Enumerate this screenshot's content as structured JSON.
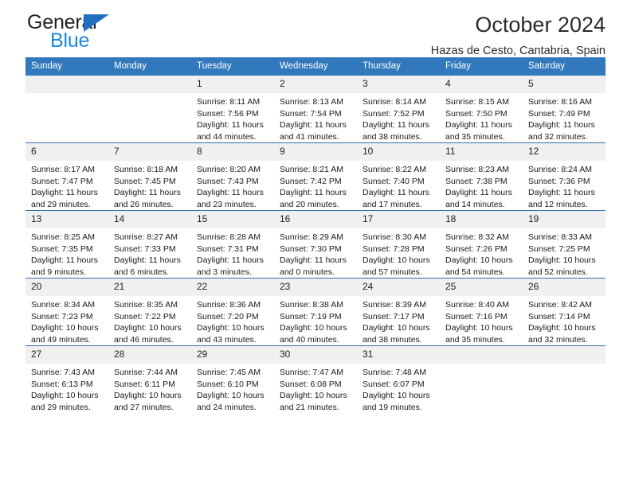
{
  "brand": {
    "name_dark": "General",
    "name_blue": "Blue",
    "accent_color": "#1b87dc",
    "triangle_color": "#1f6fc0"
  },
  "header": {
    "title": "October 2024",
    "subtitle": "Hazas de Cesto, Cantabria, Spain"
  },
  "theme": {
    "header_row_bg": "#3179bc",
    "header_row_text": "#ffffff",
    "week_divider": "#2e6fac",
    "daynum_bg": "#f0f0f0"
  },
  "weekdays": [
    "Sunday",
    "Monday",
    "Tuesday",
    "Wednesday",
    "Thursday",
    "Friday",
    "Saturday"
  ],
  "weeks": [
    [
      {
        "day": "",
        "sunrise": "",
        "sunset": "",
        "daylight1": "",
        "daylight2": "",
        "empty": true
      },
      {
        "day": "",
        "sunrise": "",
        "sunset": "",
        "daylight1": "",
        "daylight2": "",
        "empty": true
      },
      {
        "day": "1",
        "sunrise": "Sunrise: 8:11 AM",
        "sunset": "Sunset: 7:56 PM",
        "daylight1": "Daylight: 11 hours",
        "daylight2": "and 44 minutes."
      },
      {
        "day": "2",
        "sunrise": "Sunrise: 8:13 AM",
        "sunset": "Sunset: 7:54 PM",
        "daylight1": "Daylight: 11 hours",
        "daylight2": "and 41 minutes."
      },
      {
        "day": "3",
        "sunrise": "Sunrise: 8:14 AM",
        "sunset": "Sunset: 7:52 PM",
        "daylight1": "Daylight: 11 hours",
        "daylight2": "and 38 minutes."
      },
      {
        "day": "4",
        "sunrise": "Sunrise: 8:15 AM",
        "sunset": "Sunset: 7:50 PM",
        "daylight1": "Daylight: 11 hours",
        "daylight2": "and 35 minutes."
      },
      {
        "day": "5",
        "sunrise": "Sunrise: 8:16 AM",
        "sunset": "Sunset: 7:49 PM",
        "daylight1": "Daylight: 11 hours",
        "daylight2": "and 32 minutes."
      }
    ],
    [
      {
        "day": "6",
        "sunrise": "Sunrise: 8:17 AM",
        "sunset": "Sunset: 7:47 PM",
        "daylight1": "Daylight: 11 hours",
        "daylight2": "and 29 minutes."
      },
      {
        "day": "7",
        "sunrise": "Sunrise: 8:18 AM",
        "sunset": "Sunset: 7:45 PM",
        "daylight1": "Daylight: 11 hours",
        "daylight2": "and 26 minutes."
      },
      {
        "day": "8",
        "sunrise": "Sunrise: 8:20 AM",
        "sunset": "Sunset: 7:43 PM",
        "daylight1": "Daylight: 11 hours",
        "daylight2": "and 23 minutes."
      },
      {
        "day": "9",
        "sunrise": "Sunrise: 8:21 AM",
        "sunset": "Sunset: 7:42 PM",
        "daylight1": "Daylight: 11 hours",
        "daylight2": "and 20 minutes."
      },
      {
        "day": "10",
        "sunrise": "Sunrise: 8:22 AM",
        "sunset": "Sunset: 7:40 PM",
        "daylight1": "Daylight: 11 hours",
        "daylight2": "and 17 minutes."
      },
      {
        "day": "11",
        "sunrise": "Sunrise: 8:23 AM",
        "sunset": "Sunset: 7:38 PM",
        "daylight1": "Daylight: 11 hours",
        "daylight2": "and 14 minutes."
      },
      {
        "day": "12",
        "sunrise": "Sunrise: 8:24 AM",
        "sunset": "Sunset: 7:36 PM",
        "daylight1": "Daylight: 11 hours",
        "daylight2": "and 12 minutes."
      }
    ],
    [
      {
        "day": "13",
        "sunrise": "Sunrise: 8:25 AM",
        "sunset": "Sunset: 7:35 PM",
        "daylight1": "Daylight: 11 hours",
        "daylight2": "and 9 minutes."
      },
      {
        "day": "14",
        "sunrise": "Sunrise: 8:27 AM",
        "sunset": "Sunset: 7:33 PM",
        "daylight1": "Daylight: 11 hours",
        "daylight2": "and 6 minutes."
      },
      {
        "day": "15",
        "sunrise": "Sunrise: 8:28 AM",
        "sunset": "Sunset: 7:31 PM",
        "daylight1": "Daylight: 11 hours",
        "daylight2": "and 3 minutes."
      },
      {
        "day": "16",
        "sunrise": "Sunrise: 8:29 AM",
        "sunset": "Sunset: 7:30 PM",
        "daylight1": "Daylight: 11 hours",
        "daylight2": "and 0 minutes."
      },
      {
        "day": "17",
        "sunrise": "Sunrise: 8:30 AM",
        "sunset": "Sunset: 7:28 PM",
        "daylight1": "Daylight: 10 hours",
        "daylight2": "and 57 minutes."
      },
      {
        "day": "18",
        "sunrise": "Sunrise: 8:32 AM",
        "sunset": "Sunset: 7:26 PM",
        "daylight1": "Daylight: 10 hours",
        "daylight2": "and 54 minutes."
      },
      {
        "day": "19",
        "sunrise": "Sunrise: 8:33 AM",
        "sunset": "Sunset: 7:25 PM",
        "daylight1": "Daylight: 10 hours",
        "daylight2": "and 52 minutes."
      }
    ],
    [
      {
        "day": "20",
        "sunrise": "Sunrise: 8:34 AM",
        "sunset": "Sunset: 7:23 PM",
        "daylight1": "Daylight: 10 hours",
        "daylight2": "and 49 minutes."
      },
      {
        "day": "21",
        "sunrise": "Sunrise: 8:35 AM",
        "sunset": "Sunset: 7:22 PM",
        "daylight1": "Daylight: 10 hours",
        "daylight2": "and 46 minutes."
      },
      {
        "day": "22",
        "sunrise": "Sunrise: 8:36 AM",
        "sunset": "Sunset: 7:20 PM",
        "daylight1": "Daylight: 10 hours",
        "daylight2": "and 43 minutes."
      },
      {
        "day": "23",
        "sunrise": "Sunrise: 8:38 AM",
        "sunset": "Sunset: 7:19 PM",
        "daylight1": "Daylight: 10 hours",
        "daylight2": "and 40 minutes."
      },
      {
        "day": "24",
        "sunrise": "Sunrise: 8:39 AM",
        "sunset": "Sunset: 7:17 PM",
        "daylight1": "Daylight: 10 hours",
        "daylight2": "and 38 minutes."
      },
      {
        "day": "25",
        "sunrise": "Sunrise: 8:40 AM",
        "sunset": "Sunset: 7:16 PM",
        "daylight1": "Daylight: 10 hours",
        "daylight2": "and 35 minutes."
      },
      {
        "day": "26",
        "sunrise": "Sunrise: 8:42 AM",
        "sunset": "Sunset: 7:14 PM",
        "daylight1": "Daylight: 10 hours",
        "daylight2": "and 32 minutes."
      }
    ],
    [
      {
        "day": "27",
        "sunrise": "Sunrise: 7:43 AM",
        "sunset": "Sunset: 6:13 PM",
        "daylight1": "Daylight: 10 hours",
        "daylight2": "and 29 minutes."
      },
      {
        "day": "28",
        "sunrise": "Sunrise: 7:44 AM",
        "sunset": "Sunset: 6:11 PM",
        "daylight1": "Daylight: 10 hours",
        "daylight2": "and 27 minutes."
      },
      {
        "day": "29",
        "sunrise": "Sunrise: 7:45 AM",
        "sunset": "Sunset: 6:10 PM",
        "daylight1": "Daylight: 10 hours",
        "daylight2": "and 24 minutes."
      },
      {
        "day": "30",
        "sunrise": "Sunrise: 7:47 AM",
        "sunset": "Sunset: 6:08 PM",
        "daylight1": "Daylight: 10 hours",
        "daylight2": "and 21 minutes."
      },
      {
        "day": "31",
        "sunrise": "Sunrise: 7:48 AM",
        "sunset": "Sunset: 6:07 PM",
        "daylight1": "Daylight: 10 hours",
        "daylight2": "and 19 minutes."
      },
      {
        "day": "",
        "sunrise": "",
        "sunset": "",
        "daylight1": "",
        "daylight2": "",
        "empty": true
      },
      {
        "day": "",
        "sunrise": "",
        "sunset": "",
        "daylight1": "",
        "daylight2": "",
        "empty": true
      }
    ]
  ]
}
